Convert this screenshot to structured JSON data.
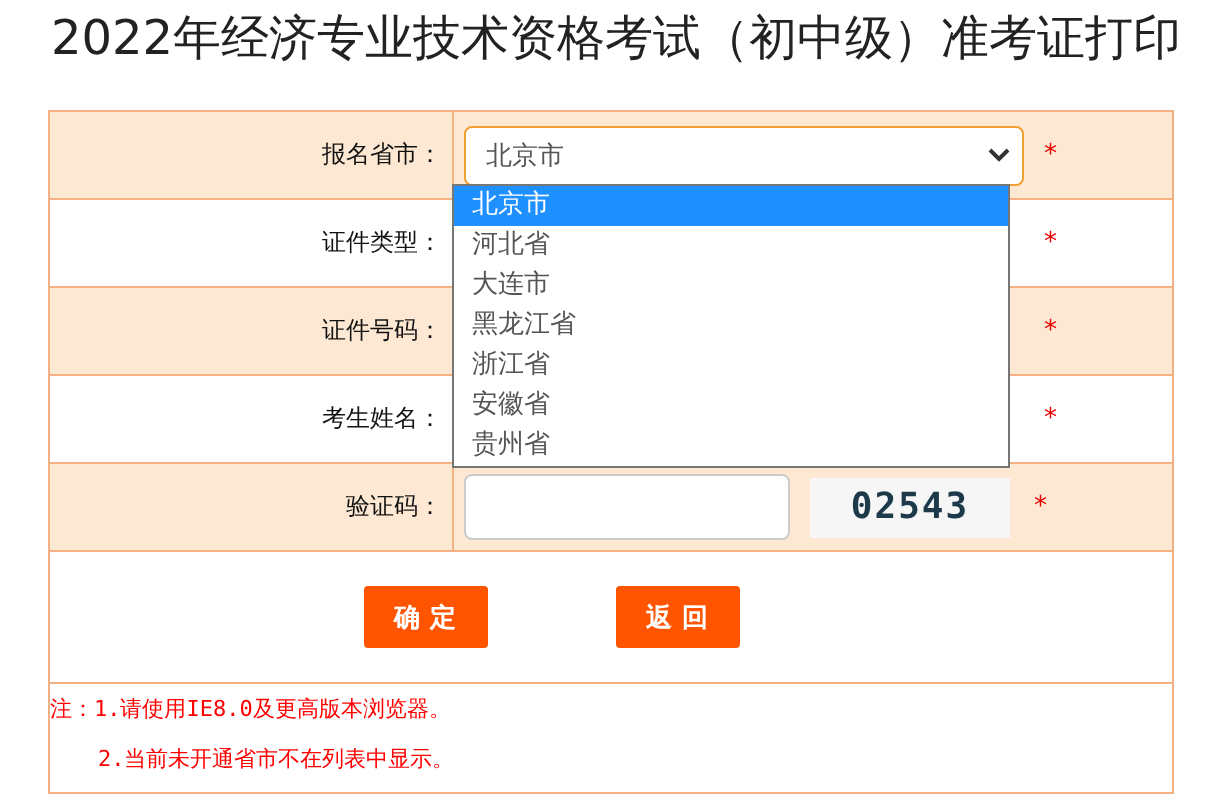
{
  "title": "2022年经济专业技术资格考试（初中级）准考证打印",
  "form": {
    "rows": [
      {
        "label": "报名省市：",
        "kind": "select",
        "value": "北京市",
        "mark": "*"
      },
      {
        "label": "证件类型：",
        "kind": "covered",
        "mark": "*"
      },
      {
        "label": "证件号码：",
        "kind": "covered",
        "mark": "*"
      },
      {
        "label": "考生姓名：",
        "kind": "covered",
        "mark": "*"
      },
      {
        "label": "验证码：",
        "kind": "captcha",
        "captcha": "02543",
        "mark": "*"
      }
    ],
    "dropdown": [
      {
        "label": "北京市",
        "selected": true
      },
      {
        "label": "河北省",
        "selected": false
      },
      {
        "label": "大连市",
        "selected": false
      },
      {
        "label": "黑龙江省",
        "selected": false
      },
      {
        "label": "浙江省",
        "selected": false
      },
      {
        "label": "安徽省",
        "selected": false
      },
      {
        "label": "贵州省",
        "selected": false
      }
    ]
  },
  "buttons": [
    "确 定",
    "返 回"
  ],
  "notes": [
    "注：1.请使用IE8.0及更高版本浏览器。",
    "2.当前未开通省市不在列表中显示。"
  ]
}
